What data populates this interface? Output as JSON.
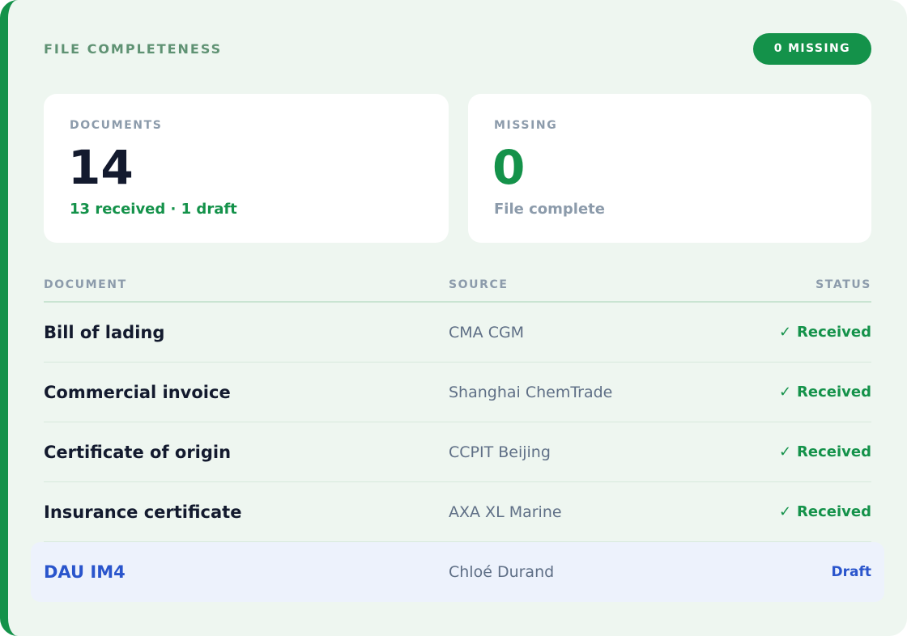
{
  "header": {
    "title": "FILE COMPLETENESS",
    "missing_badge": "0 MISSING"
  },
  "cards": {
    "documents": {
      "label": "DOCUMENTS",
      "value": "14",
      "sub": "13 received · 1 draft"
    },
    "missing": {
      "label": "MISSING",
      "value": "0",
      "sub": "File complete"
    }
  },
  "table": {
    "columns": {
      "document": "DOCUMENT",
      "source": "SOURCE",
      "status": "STATUS"
    },
    "rows": [
      {
        "document": "Bill of lading",
        "source": "CMA CGM",
        "status": "Received"
      },
      {
        "document": "Commercial invoice",
        "source": "Shanghai ChemTrade",
        "status": "Received"
      },
      {
        "document": "Certificate of origin",
        "source": "CCPIT Beijing",
        "status": "Received"
      },
      {
        "document": "Insurance certificate",
        "source": "AXA XL Marine",
        "status": "Received"
      },
      {
        "document": "DAU IM4",
        "source": "Chloé Durand",
        "status": "Draft"
      }
    ]
  },
  "colors": {
    "accent_green": "#14924a",
    "draft_blue": "#2a55cc",
    "panel_bg": "#eef6f0"
  },
  "icons": {
    "received": "check-icon"
  }
}
